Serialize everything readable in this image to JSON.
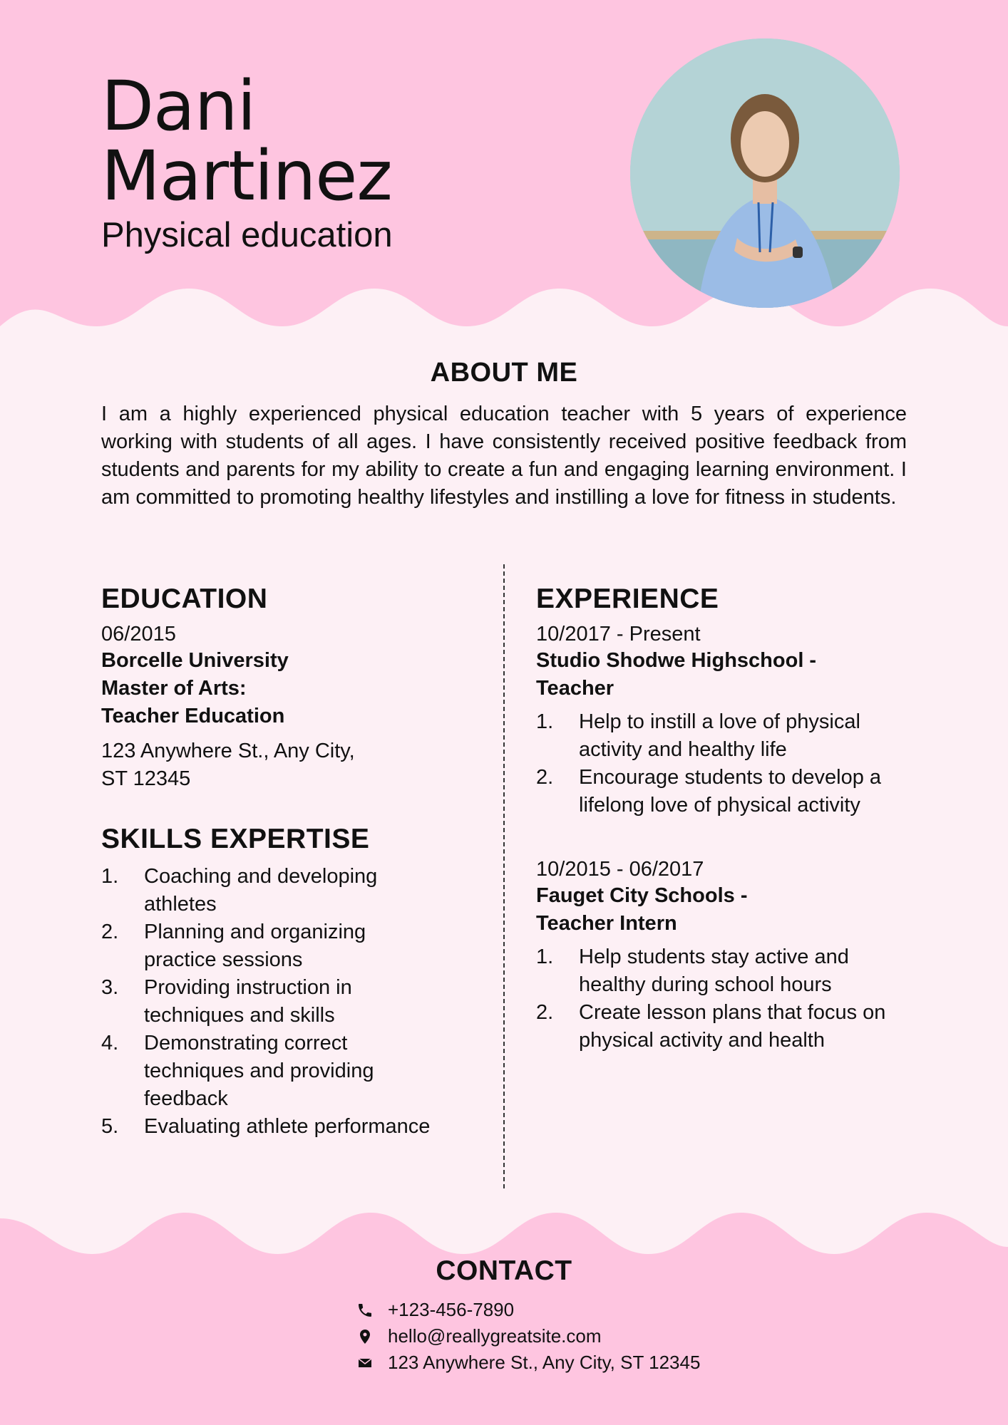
{
  "header": {
    "first_name": "Dani",
    "last_name": "Martinez",
    "role": "Physical education"
  },
  "about": {
    "title": "ABOUT ME",
    "text": "I am a highly experienced physical education teacher with 5 years of experience working with students of all ages. I have consistently received positive feedback from students and parents for my ability to create a fun and engaging learning environment. I am committed to promoting healthy lifestyles and instilling a love for fitness in students."
  },
  "education": {
    "title": "EDUCATION",
    "date": "06/2015",
    "school": "Borcelle University",
    "degree_line1": "Master of Arts:",
    "degree_line2": "Teacher Education",
    "address_line1": "123 Anywhere St., Any City,",
    "address_line2": "ST 12345"
  },
  "skills": {
    "title": "SKILLS EXPERTISE",
    "items": [
      {
        "num": "1.",
        "text": "Coaching and developing athletes"
      },
      {
        "num": "2.",
        "text": "Planning and organizing practice sessions"
      },
      {
        "num": "3.",
        "text": "Providing instruction in techniques and skills"
      },
      {
        "num": "4.",
        "text": "Demonstrating correct techniques and providing feedback"
      },
      {
        "num": "5.",
        "text": "Evaluating athlete performance"
      }
    ]
  },
  "experience": {
    "title": "EXPERIENCE",
    "jobs": [
      {
        "date": "10/2017 - Present",
        "org_line1": "Studio Shodwe Highschool -",
        "org_line2": "Teacher",
        "items": [
          {
            "num": "1.",
            "text": "Help to instill a love of physical activity and healthy life"
          },
          {
            "num": "2.",
            "text": "Encourage students to develop a lifelong love of physical activity"
          }
        ]
      },
      {
        "date": "10/2015 - 06/2017",
        "org_line1": "Fauget City Schools -",
        "org_line2": "Teacher Intern",
        "items": [
          {
            "num": "1.",
            "text": "Help students stay active and healthy during school hours"
          },
          {
            "num": "2.",
            "text": "Create lesson plans that focus on physical activity and health"
          }
        ]
      }
    ]
  },
  "contact": {
    "title": "CONTACT",
    "phone": "+123-456-7890",
    "email": "hello@reallygreatsite.com",
    "address": "123 Anywhere St., Any City, ST 12345",
    "icons": [
      "phone-icon",
      "location-pin-icon",
      "mail-icon"
    ]
  },
  "colors": {
    "pink_band": "#fec5e0",
    "page_background": "#fdf0f5",
    "text": "#111111"
  }
}
